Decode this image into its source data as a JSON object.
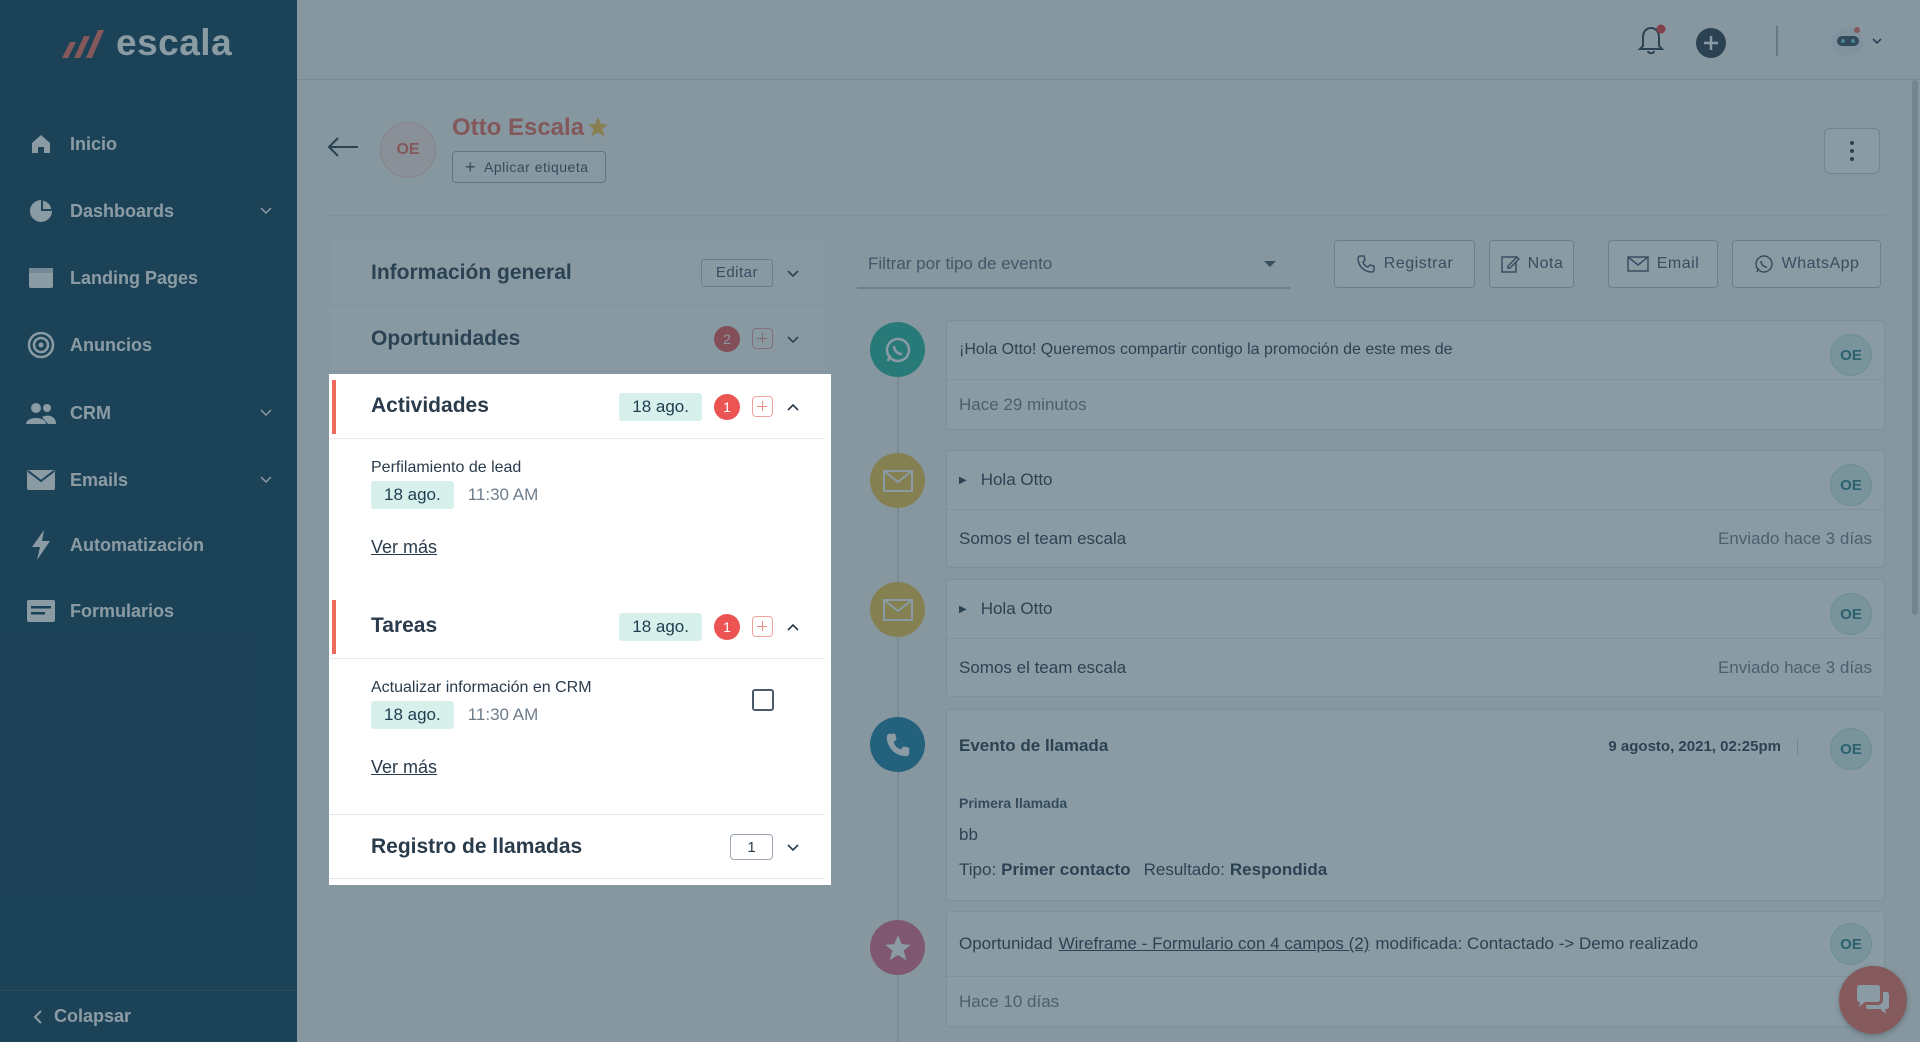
{
  "brand": {
    "logo_text": "escala",
    "logo_mark": "escala-slashes-logo",
    "accent": "#ee6b5c",
    "sidebar_bg": "#0b3a56"
  },
  "sidebar": {
    "items": [
      {
        "label": "Inicio",
        "icon": "home-icon"
      },
      {
        "label": "Dashboards",
        "icon": "pie-chart-icon"
      },
      {
        "label": "Landing Pages",
        "icon": "browser-window-icon"
      },
      {
        "label": "Anuncios",
        "icon": "target-icon"
      },
      {
        "label": "CRM",
        "icon": "people-icon"
      },
      {
        "label": "Emails",
        "icon": "envelope-icon"
      },
      {
        "label": "Automatización",
        "icon": "lightning-icon"
      },
      {
        "label": "Formularios",
        "icon": "form-icon"
      }
    ],
    "collapse_label": "Colapsar"
  },
  "contact": {
    "name": "Otto Escala",
    "initials": "OE",
    "starred": true,
    "tag_button": "Aplicar etiqueta"
  },
  "panels": {
    "general": {
      "title": "Información general",
      "edit_label": "Editar"
    },
    "opportunities": {
      "title": "Oportunidades",
      "count": "2"
    },
    "activities": {
      "title": "Actividades",
      "date": "18 ago.",
      "count": "1",
      "item": {
        "title": "Perfilamiento de lead",
        "date": "18 ago.",
        "time": "11:30 AM"
      },
      "more": "Ver más"
    },
    "tasks": {
      "title": "Tareas",
      "date": "18 ago.",
      "count": "1",
      "item": {
        "title": "Actualizar información en CRM",
        "date": "18 ago.",
        "time": "11:30 AM",
        "done": false
      },
      "more": "Ver más"
    },
    "calls": {
      "title": "Registro de llamadas",
      "count": "1"
    }
  },
  "timeline": {
    "filter_placeholder": "Filtrar por tipo de evento",
    "actions": [
      {
        "label": "Registrar",
        "icon": "phone-icon"
      },
      {
        "label": "Nota",
        "icon": "note-icon"
      },
      {
        "label": "Email",
        "icon": "envelope-icon"
      },
      {
        "label": "WhatsApp",
        "icon": "whatsapp-icon"
      }
    ],
    "events": [
      {
        "type": "whatsapp",
        "icon": "whatsapp-icon",
        "color": "#25b5a0",
        "text": "¡Hola Otto! Queremos compartir contigo la promoción de este mes de",
        "time": "Hace 29 minutos",
        "initials": "OE"
      },
      {
        "type": "email",
        "icon": "envelope-icon",
        "color": "#f2c44b",
        "subject": "Hola Otto",
        "body": "Somos el team escala",
        "sent": "Enviado hace 3 días",
        "initials": "OE"
      },
      {
        "type": "email",
        "icon": "envelope-icon",
        "color": "#f2c44b",
        "subject": "Hola Otto",
        "body": "Somos el team escala",
        "sent": "Enviado hace 3 días",
        "initials": "OE"
      },
      {
        "type": "call",
        "icon": "phone-icon",
        "color": "#1c7ea8",
        "title": "Evento de llamada",
        "datetime": "9 agosto, 2021, 02:25pm",
        "call_name": "Primera llamada",
        "note": "bb",
        "type_label": "Tipo:",
        "type_value": "Primer contacto",
        "result_label": "Resultado:",
        "result_value": "Respondida",
        "initials": "OE"
      },
      {
        "type": "opportunity",
        "icon": "star-icon",
        "color": "#e46a8c",
        "prefix": "Oportunidad",
        "link": "Wireframe - Formulario con 4 campos (2)",
        "suffix": "modificada: Contactado -> Demo realizado",
        "time": "Hace 10 días",
        "initials": "OE"
      }
    ]
  }
}
